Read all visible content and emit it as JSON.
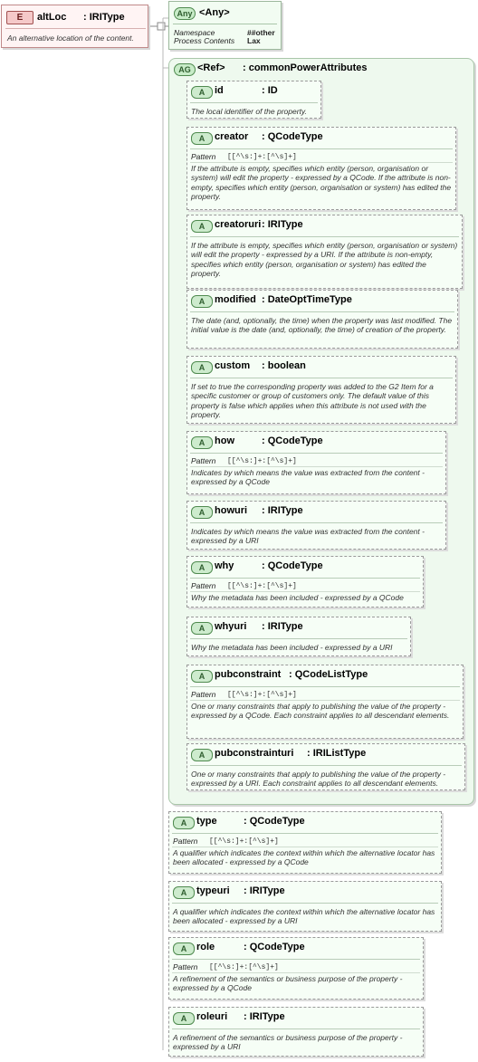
{
  "element": {
    "badge": "E",
    "name": "altLoc",
    "type": ": IRIType",
    "doc": "An alternative location of the content."
  },
  "any": {
    "badge": "Any",
    "title": "<Any>",
    "props": [
      {
        "key": "Namespace",
        "value": "##other"
      },
      {
        "key": "Process Contents",
        "value": "Lax"
      }
    ]
  },
  "group": {
    "badge": "AG",
    "title": "<Ref>",
    "type": ": commonPowerAttributes"
  },
  "pattern_label": "Pattern",
  "attributes": [
    {
      "badge": "A",
      "name": "id",
      "type": ": ID",
      "pattern": "",
      "doc": "The local identifier of the property."
    },
    {
      "badge": "A",
      "name": "creator",
      "type": ": QCodeType",
      "pattern": "[[^\\s:]+:[^\\s]+]",
      "doc": "If the attribute is empty, specifies which entity (person, organisation or system) will edit the property - expressed by a QCode. If the attribute is non-empty, specifies which entity (person, organisation or system) has edited the property."
    },
    {
      "badge": "A",
      "name": "creatoruri",
      "type": ": IRIType",
      "pattern": "",
      "doc": "If the attribute is empty, specifies which entity (person, organisation or system) will edit the property - expressed by a URI. If the attribute is non-empty, specifies which entity (person, organisation or system) has edited the property."
    },
    {
      "badge": "A",
      "name": "modified",
      "type": ": DateOptTimeType",
      "pattern": "",
      "doc": "The date (and, optionally, the time) when the property was last modified. The initial value is the date (and, optionally, the time) of creation of the property."
    },
    {
      "badge": "A",
      "name": "custom",
      "type": ": boolean",
      "pattern": "",
      "doc": "If set to true the corresponding property was added to the G2 Item for a specific customer or group of customers only. The default value of this property is false which applies when this attribute is not used with the property."
    },
    {
      "badge": "A",
      "name": "how",
      "type": ": QCodeType",
      "pattern": "[[^\\s:]+:[^\\s]+]",
      "doc": "Indicates by which means the value was extracted from the content - expressed by a QCode"
    },
    {
      "badge": "A",
      "name": "howuri",
      "type": ": IRIType",
      "pattern": "",
      "doc": "Indicates by which means the value was extracted from the content - expressed by a URI"
    },
    {
      "badge": "A",
      "name": "why",
      "type": ": QCodeType",
      "pattern": "[[^\\s:]+:[^\\s]+]",
      "doc": "Why the metadata has been included - expressed by a QCode"
    },
    {
      "badge": "A",
      "name": "whyuri",
      "type": ": IRIType",
      "pattern": "",
      "doc": "Why the metadata has been included - expressed by a URI"
    },
    {
      "badge": "A",
      "name": "pubconstraint",
      "type": ": QCodeListType",
      "pattern": "[[^\\s:]+:[^\\s]+]",
      "doc": "One or many constraints that apply to publishing the value of the property - expressed by a QCode. Each constraint applies to all descendant elements."
    },
    {
      "badge": "A",
      "name": "pubconstrainturi",
      "type": ": IRIListType",
      "pattern": "",
      "doc": "One or many constraints that apply to publishing the value of the property - expressed by a URI. Each constraint applies to all descendant elements."
    },
    {
      "badge": "A",
      "name": "type",
      "type": ": QCodeType",
      "pattern": "[[^\\s:]+:[^\\s]+]",
      "doc": "A qualifier which indicates the context within which the alternative locator has been allocated - expressed by a QCode"
    },
    {
      "badge": "A",
      "name": "typeuri",
      "type": ": IRIType",
      "pattern": "",
      "doc": "A qualifier which indicates the context within which the alternative locator has been allocated - expressed by a URI"
    },
    {
      "badge": "A",
      "name": "role",
      "type": ": QCodeType",
      "pattern": "[[^\\s:]+:[^\\s]+]",
      "doc": "A refinement of the semantics or business purpose of the property - expressed by a QCode"
    },
    {
      "badge": "A",
      "name": "roleuri",
      "type": ": IRIType",
      "pattern": "",
      "doc": "A refinement of the semantics or business purpose of the property - expressed by a URI"
    }
  ]
}
